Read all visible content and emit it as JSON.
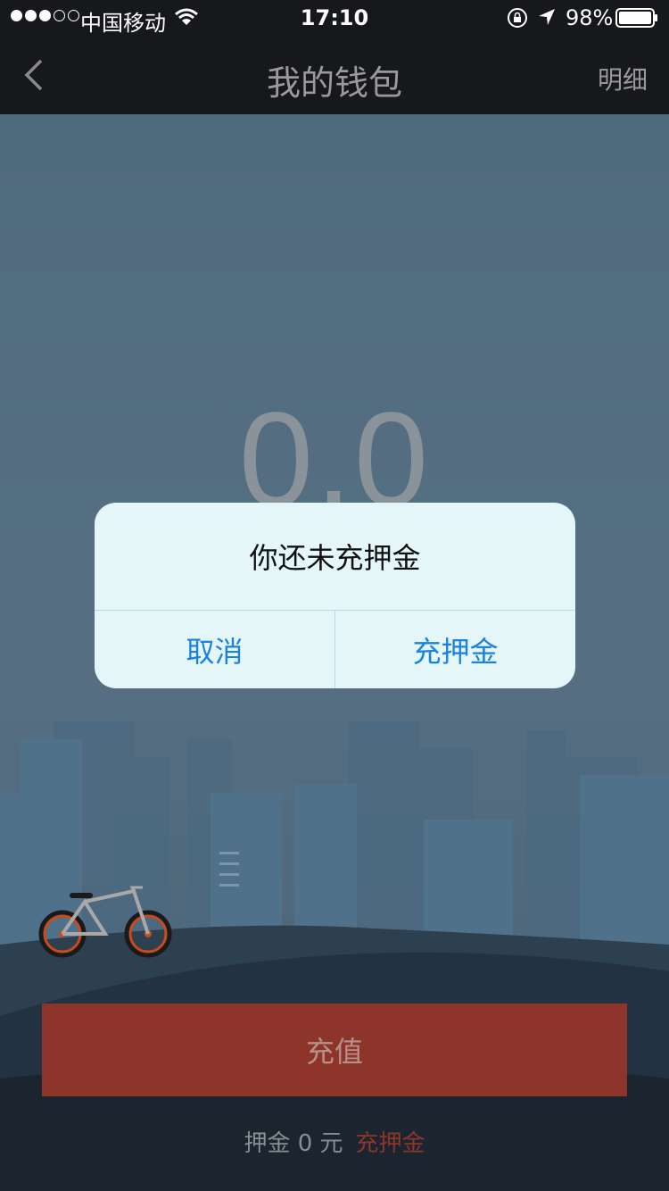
{
  "status_bar": {
    "carrier": "中国移动",
    "time": "17:10",
    "battery": "98%"
  },
  "nav": {
    "title": "我的钱包",
    "detail": "明细"
  },
  "wallet": {
    "balance": "0.0",
    "recharge_label": "充值",
    "deposit_text": "押金 0 元",
    "deposit_link": "充押金"
  },
  "alert": {
    "message": "你还未充押金",
    "cancel_label": "取消",
    "confirm_label": "充押金"
  },
  "colors": {
    "accent_red": "#8e352b",
    "ios_blue": "#1a82e0"
  }
}
